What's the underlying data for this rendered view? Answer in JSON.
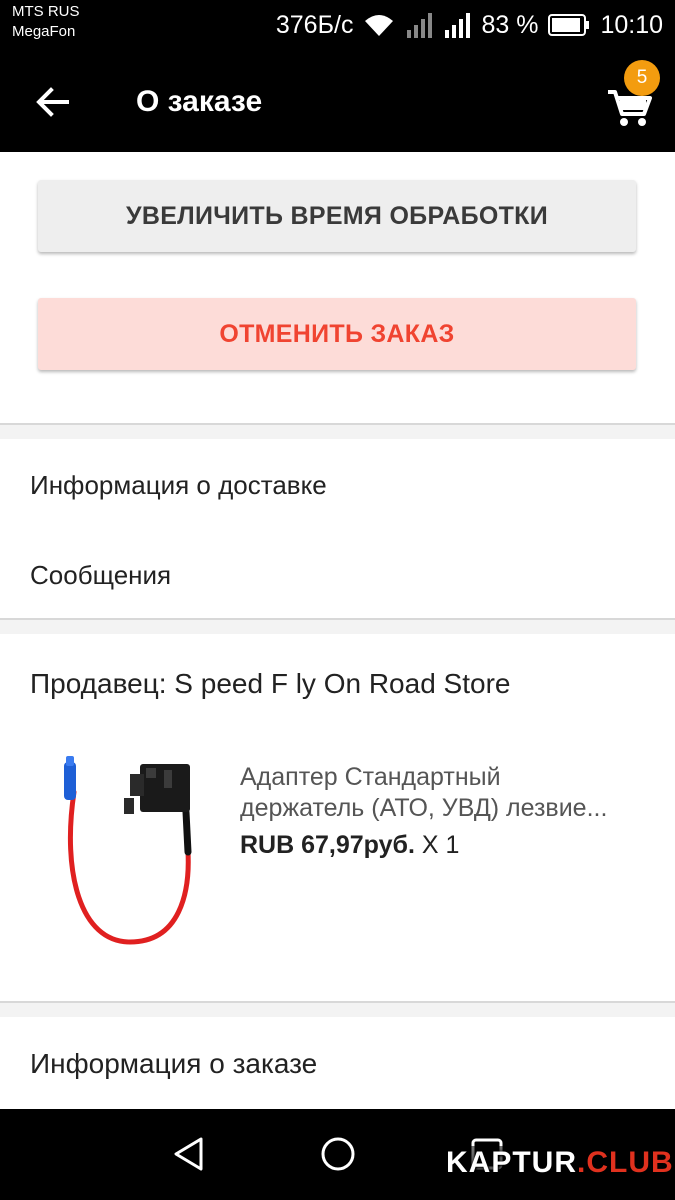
{
  "status_bar": {
    "carrier_1": "MTS RUS",
    "carrier_2": "MegaFon",
    "speed": "376Б/с",
    "battery": "83 %",
    "time": "10:10",
    "icons": [
      "wifi-icon",
      "signal-icon",
      "signal-icon",
      "battery-icon"
    ]
  },
  "app_bar": {
    "title": "О заказе",
    "cart_count": "5",
    "icons": [
      "back-arrow-icon",
      "cart-icon"
    ]
  },
  "actions": {
    "extend_label": "УВЕЛИЧИТЬ ВРЕМЯ ОБРАБОТКИ",
    "cancel_label": "ОТМЕНИТЬ ЗАКАЗ"
  },
  "links": {
    "delivery": "Информация о доставке",
    "messages": "Сообщения"
  },
  "seller": {
    "label": "Продавец: S peed F ly On Road Store"
  },
  "product": {
    "name_line1": "Адаптер Стандартный",
    "name_line2": "держатель (АТО, УВД) лезвие...",
    "price": "RUB 67,97руб.",
    "quantity": "X 1"
  },
  "order_info": {
    "title": "Информация о заказе"
  },
  "watermark": {
    "part1": "KAPTUR",
    "part2": ".CLUB"
  },
  "colors": {
    "accent": "#f04431",
    "badge": "#f39c0f",
    "cancel_bg": "#fddcd8"
  }
}
